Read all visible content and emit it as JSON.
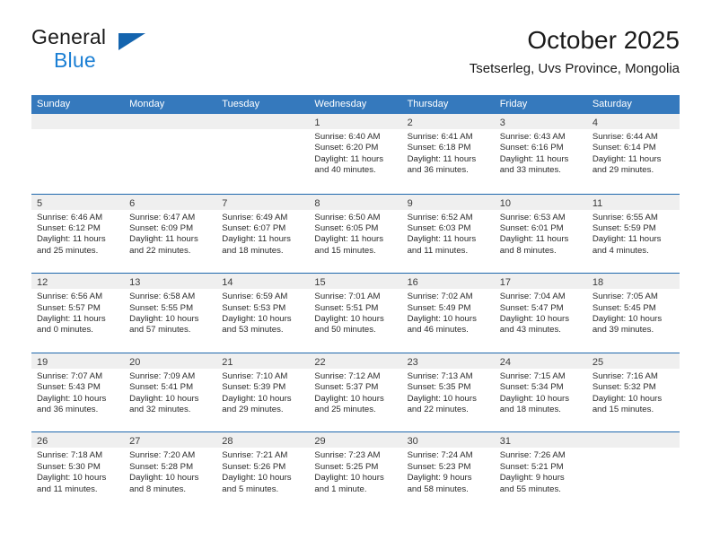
{
  "brand": {
    "name_part1": "General",
    "name_part2": "Blue",
    "triangle_color": "#1464ae",
    "blue_color": "#1b7fd4"
  },
  "header": {
    "title": "October 2025",
    "subtitle": "Tsetserleg, Uvs Province, Mongolia"
  },
  "colors": {
    "header_row_bg": "#3579bd",
    "header_row_text": "#ffffff",
    "daynum_band_bg": "#efefef",
    "row_divider": "#1f68ad"
  },
  "weekdays": [
    "Sunday",
    "Monday",
    "Tuesday",
    "Wednesday",
    "Thursday",
    "Friday",
    "Saturday"
  ],
  "labels": {
    "sunrise_prefix": "Sunrise:",
    "sunset_prefix": "Sunset:",
    "daylight_prefix": "Daylight:"
  },
  "weeks": [
    [
      {
        "day": "",
        "sunrise": "",
        "sunset": "",
        "daylight_line1": "",
        "daylight_line2": ""
      },
      {
        "day": "",
        "sunrise": "",
        "sunset": "",
        "daylight_line1": "",
        "daylight_line2": ""
      },
      {
        "day": "",
        "sunrise": "",
        "sunset": "",
        "daylight_line1": "",
        "daylight_line2": ""
      },
      {
        "day": "1",
        "sunrise": "Sunrise: 6:40 AM",
        "sunset": "Sunset: 6:20 PM",
        "daylight_line1": "Daylight: 11 hours",
        "daylight_line2": "and 40 minutes."
      },
      {
        "day": "2",
        "sunrise": "Sunrise: 6:41 AM",
        "sunset": "Sunset: 6:18 PM",
        "daylight_line1": "Daylight: 11 hours",
        "daylight_line2": "and 36 minutes."
      },
      {
        "day": "3",
        "sunrise": "Sunrise: 6:43 AM",
        "sunset": "Sunset: 6:16 PM",
        "daylight_line1": "Daylight: 11 hours",
        "daylight_line2": "and 33 minutes."
      },
      {
        "day": "4",
        "sunrise": "Sunrise: 6:44 AM",
        "sunset": "Sunset: 6:14 PM",
        "daylight_line1": "Daylight: 11 hours",
        "daylight_line2": "and 29 minutes."
      }
    ],
    [
      {
        "day": "5",
        "sunrise": "Sunrise: 6:46 AM",
        "sunset": "Sunset: 6:12 PM",
        "daylight_line1": "Daylight: 11 hours",
        "daylight_line2": "and 25 minutes."
      },
      {
        "day": "6",
        "sunrise": "Sunrise: 6:47 AM",
        "sunset": "Sunset: 6:09 PM",
        "daylight_line1": "Daylight: 11 hours",
        "daylight_line2": "and 22 minutes."
      },
      {
        "day": "7",
        "sunrise": "Sunrise: 6:49 AM",
        "sunset": "Sunset: 6:07 PM",
        "daylight_line1": "Daylight: 11 hours",
        "daylight_line2": "and 18 minutes."
      },
      {
        "day": "8",
        "sunrise": "Sunrise: 6:50 AM",
        "sunset": "Sunset: 6:05 PM",
        "daylight_line1": "Daylight: 11 hours",
        "daylight_line2": "and 15 minutes."
      },
      {
        "day": "9",
        "sunrise": "Sunrise: 6:52 AM",
        "sunset": "Sunset: 6:03 PM",
        "daylight_line1": "Daylight: 11 hours",
        "daylight_line2": "and 11 minutes."
      },
      {
        "day": "10",
        "sunrise": "Sunrise: 6:53 AM",
        "sunset": "Sunset: 6:01 PM",
        "daylight_line1": "Daylight: 11 hours",
        "daylight_line2": "and 8 minutes."
      },
      {
        "day": "11",
        "sunrise": "Sunrise: 6:55 AM",
        "sunset": "Sunset: 5:59 PM",
        "daylight_line1": "Daylight: 11 hours",
        "daylight_line2": "and 4 minutes."
      }
    ],
    [
      {
        "day": "12",
        "sunrise": "Sunrise: 6:56 AM",
        "sunset": "Sunset: 5:57 PM",
        "daylight_line1": "Daylight: 11 hours",
        "daylight_line2": "and 0 minutes."
      },
      {
        "day": "13",
        "sunrise": "Sunrise: 6:58 AM",
        "sunset": "Sunset: 5:55 PM",
        "daylight_line1": "Daylight: 10 hours",
        "daylight_line2": "and 57 minutes."
      },
      {
        "day": "14",
        "sunrise": "Sunrise: 6:59 AM",
        "sunset": "Sunset: 5:53 PM",
        "daylight_line1": "Daylight: 10 hours",
        "daylight_line2": "and 53 minutes."
      },
      {
        "day": "15",
        "sunrise": "Sunrise: 7:01 AM",
        "sunset": "Sunset: 5:51 PM",
        "daylight_line1": "Daylight: 10 hours",
        "daylight_line2": "and 50 minutes."
      },
      {
        "day": "16",
        "sunrise": "Sunrise: 7:02 AM",
        "sunset": "Sunset: 5:49 PM",
        "daylight_line1": "Daylight: 10 hours",
        "daylight_line2": "and 46 minutes."
      },
      {
        "day": "17",
        "sunrise": "Sunrise: 7:04 AM",
        "sunset": "Sunset: 5:47 PM",
        "daylight_line1": "Daylight: 10 hours",
        "daylight_line2": "and 43 minutes."
      },
      {
        "day": "18",
        "sunrise": "Sunrise: 7:05 AM",
        "sunset": "Sunset: 5:45 PM",
        "daylight_line1": "Daylight: 10 hours",
        "daylight_line2": "and 39 minutes."
      }
    ],
    [
      {
        "day": "19",
        "sunrise": "Sunrise: 7:07 AM",
        "sunset": "Sunset: 5:43 PM",
        "daylight_line1": "Daylight: 10 hours",
        "daylight_line2": "and 36 minutes."
      },
      {
        "day": "20",
        "sunrise": "Sunrise: 7:09 AM",
        "sunset": "Sunset: 5:41 PM",
        "daylight_line1": "Daylight: 10 hours",
        "daylight_line2": "and 32 minutes."
      },
      {
        "day": "21",
        "sunrise": "Sunrise: 7:10 AM",
        "sunset": "Sunset: 5:39 PM",
        "daylight_line1": "Daylight: 10 hours",
        "daylight_line2": "and 29 minutes."
      },
      {
        "day": "22",
        "sunrise": "Sunrise: 7:12 AM",
        "sunset": "Sunset: 5:37 PM",
        "daylight_line1": "Daylight: 10 hours",
        "daylight_line2": "and 25 minutes."
      },
      {
        "day": "23",
        "sunrise": "Sunrise: 7:13 AM",
        "sunset": "Sunset: 5:35 PM",
        "daylight_line1": "Daylight: 10 hours",
        "daylight_line2": "and 22 minutes."
      },
      {
        "day": "24",
        "sunrise": "Sunrise: 7:15 AM",
        "sunset": "Sunset: 5:34 PM",
        "daylight_line1": "Daylight: 10 hours",
        "daylight_line2": "and 18 minutes."
      },
      {
        "day": "25",
        "sunrise": "Sunrise: 7:16 AM",
        "sunset": "Sunset: 5:32 PM",
        "daylight_line1": "Daylight: 10 hours",
        "daylight_line2": "and 15 minutes."
      }
    ],
    [
      {
        "day": "26",
        "sunrise": "Sunrise: 7:18 AM",
        "sunset": "Sunset: 5:30 PM",
        "daylight_line1": "Daylight: 10 hours",
        "daylight_line2": "and 11 minutes."
      },
      {
        "day": "27",
        "sunrise": "Sunrise: 7:20 AM",
        "sunset": "Sunset: 5:28 PM",
        "daylight_line1": "Daylight: 10 hours",
        "daylight_line2": "and 8 minutes."
      },
      {
        "day": "28",
        "sunrise": "Sunrise: 7:21 AM",
        "sunset": "Sunset: 5:26 PM",
        "daylight_line1": "Daylight: 10 hours",
        "daylight_line2": "and 5 minutes."
      },
      {
        "day": "29",
        "sunrise": "Sunrise: 7:23 AM",
        "sunset": "Sunset: 5:25 PM",
        "daylight_line1": "Daylight: 10 hours",
        "daylight_line2": "and 1 minute."
      },
      {
        "day": "30",
        "sunrise": "Sunrise: 7:24 AM",
        "sunset": "Sunset: 5:23 PM",
        "daylight_line1": "Daylight: 9 hours",
        "daylight_line2": "and 58 minutes."
      },
      {
        "day": "31",
        "sunrise": "Sunrise: 7:26 AM",
        "sunset": "Sunset: 5:21 PM",
        "daylight_line1": "Daylight: 9 hours",
        "daylight_line2": "and 55 minutes."
      },
      {
        "day": "",
        "sunrise": "",
        "sunset": "",
        "daylight_line1": "",
        "daylight_line2": ""
      }
    ]
  ]
}
